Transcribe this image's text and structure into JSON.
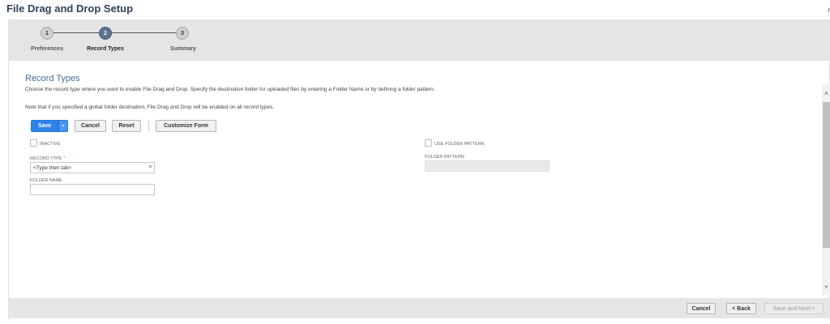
{
  "page": {
    "title": "File Drag and Drop Setup",
    "corner_mark": "r"
  },
  "wizard": {
    "steps": [
      {
        "number": "1",
        "label": "Preferences",
        "active": false
      },
      {
        "number": "2",
        "label": "Record Types",
        "active": true
      },
      {
        "number": "3",
        "label": "Summary",
        "active": false
      }
    ]
  },
  "section": {
    "title": "Record Types",
    "description": "Choose the record type where you want to enable File Drag and Drop. Specify the destination folder for uploaded files by entering a Folder Name or by defining a folder pattern.",
    "note": "Note that if you specified a global folder destination, File Drag and Drop will be enabled on all record types."
  },
  "toolbar": {
    "save_label": "Save",
    "save_menu_glyph": "▾",
    "cancel_label": "Cancel",
    "reset_label": "Reset",
    "customize_label": "Customize Form"
  },
  "form": {
    "inactive_label": "INACTIVE",
    "inactive_checked": false,
    "record_type_label": "RECORD TYPE",
    "required_marker": "*",
    "record_type_value": "<Type then tab>",
    "record_type_arrow": "»",
    "folder_name_label": "FOLDER NAME",
    "folder_name_value": "",
    "use_folder_pattern_label": "USE FOLDER PATTERN",
    "use_folder_pattern_checked": false,
    "folder_pattern_label": "FOLDER PATTERN",
    "folder_pattern_value": ""
  },
  "scrollbar": {
    "up_glyph": "˄",
    "down_glyph": "˅"
  },
  "footer": {
    "cancel_label": "Cancel",
    "back_label": "< Back",
    "next_label": "Save and Next >"
  },
  "colors": {
    "title": "#30425a",
    "active_step": "#5c7191",
    "primary_button": "#2f82e8",
    "section_title": "#456c97",
    "required": "#e8a33c"
  }
}
